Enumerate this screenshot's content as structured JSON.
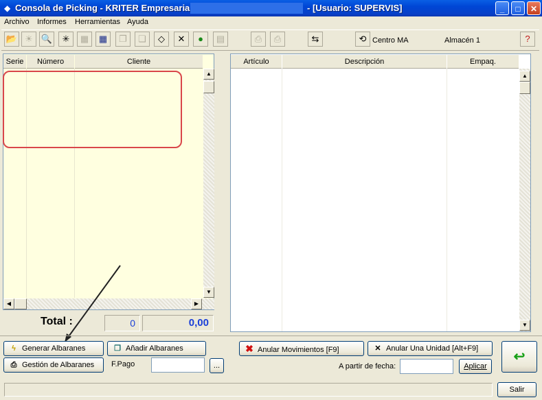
{
  "window": {
    "title": "Consola de Picking - KRITER Empresarial -",
    "user": "- [Usuario: SUPERVIS]",
    "minimize": "_",
    "maximize": "□",
    "close": "✕"
  },
  "menu": [
    "Archivo",
    "Informes",
    "Herramientas",
    "Ayuda"
  ],
  "toolbar": {
    "centro": "Centro MA",
    "almacen": "Almacén 1"
  },
  "left_grid": {
    "columns": [
      "Serie",
      "Número",
      "Cliente"
    ],
    "total_label": "Total :",
    "total_count": "0",
    "total_amount": "0,00"
  },
  "right_grid": {
    "columns": [
      "Artículo",
      "Descripción",
      "Empaq."
    ]
  },
  "buttons": {
    "generar": "Generar Albaranes",
    "anadir": "Añadir Albaranes",
    "gestion": "Gestión de Albaranes",
    "fpago_label": "F.Pago",
    "ellipsis": "...",
    "anular_mov": "Anular Movimientos [F9]",
    "anular_unidad": "Anular Una Unidad [Alt+F9]",
    "fecha_label": "A partir de fecha:",
    "aplicar": "Aplicar",
    "salir": "Salir"
  }
}
